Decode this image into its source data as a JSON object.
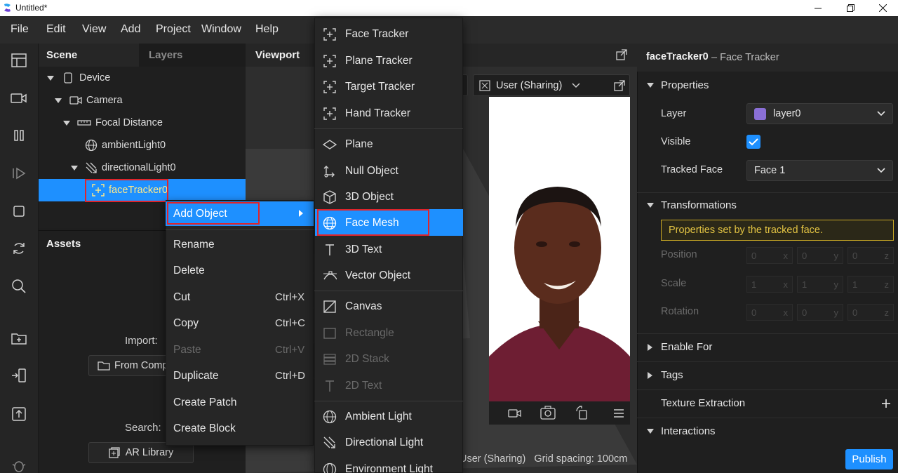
{
  "window": {
    "title": "Untitled*",
    "controls": [
      "—",
      "❐",
      "✕"
    ]
  },
  "menubar": [
    "File",
    "Edit",
    "View",
    "Add",
    "Project",
    "Window",
    "Help"
  ],
  "scene": {
    "tab_scene": "Scene",
    "tab_layers": "Layers",
    "tree": [
      {
        "label": "Device",
        "icon": "phone-icon"
      },
      {
        "label": "Camera",
        "icon": "camera-icon"
      },
      {
        "label": "Focal Distance",
        "icon": "ruler-icon"
      },
      {
        "label": "ambientLight0",
        "icon": "globe-icon"
      },
      {
        "label": "directionalLight0",
        "icon": "directional-light-icon"
      },
      {
        "label": "faceTracker0",
        "icon": "face-tracker-icon"
      }
    ]
  },
  "assets": {
    "title": "Assets",
    "import_label": "Import:",
    "from_computer": "From Comp",
    "search_label": "Search:",
    "ar_library": "AR Library"
  },
  "viewport": {
    "title": "Viewport",
    "sim_mode": "User (Sharing)",
    "status": "User (Sharing)   Grid spacing: 100cm"
  },
  "context_menu": {
    "items": [
      {
        "label": "Add Object",
        "shortcut": "",
        "disabled": false
      },
      {
        "label": "Rename",
        "shortcut": "",
        "disabled": false
      },
      {
        "label": "Delete",
        "shortcut": "",
        "disabled": false
      },
      {
        "label": "Cut",
        "shortcut": "Ctrl+X",
        "disabled": false
      },
      {
        "label": "Copy",
        "shortcut": "Ctrl+C",
        "disabled": false
      },
      {
        "label": "Paste",
        "shortcut": "Ctrl+V",
        "disabled": true
      },
      {
        "label": "Duplicate",
        "shortcut": "Ctrl+D",
        "disabled": false
      },
      {
        "label": "Create Patch",
        "shortcut": "",
        "disabled": false
      },
      {
        "label": "Create Block",
        "shortcut": "",
        "disabled": false
      }
    ]
  },
  "submenu": {
    "items": [
      {
        "label": "Face Tracker",
        "icon": "tracker-icon",
        "disabled": false
      },
      {
        "label": "Plane Tracker",
        "icon": "tracker-icon",
        "disabled": false
      },
      {
        "label": "Target Tracker",
        "icon": "tracker-icon",
        "disabled": false
      },
      {
        "label": "Hand Tracker",
        "icon": "tracker-icon",
        "disabled": false
      },
      {
        "label": "Plane",
        "icon": "plane-icon",
        "disabled": false
      },
      {
        "label": "Null Object",
        "icon": "null-object-icon",
        "disabled": false
      },
      {
        "label": "3D Object",
        "icon": "cube-icon",
        "disabled": false
      },
      {
        "label": "Face Mesh",
        "icon": "globe-icon",
        "disabled": false
      },
      {
        "label": "3D Text",
        "icon": "text-icon",
        "disabled": false
      },
      {
        "label": "Vector Object",
        "icon": "vector-icon",
        "disabled": false
      },
      {
        "label": "Canvas",
        "icon": "canvas-icon",
        "disabled": false
      },
      {
        "label": "Rectangle",
        "icon": "rectangle-icon",
        "disabled": true
      },
      {
        "label": "2D Stack",
        "icon": "stack-icon",
        "disabled": true
      },
      {
        "label": "2D Text",
        "icon": "text-icon",
        "disabled": true
      },
      {
        "label": "Ambient Light",
        "icon": "globe-icon",
        "disabled": false
      },
      {
        "label": "Directional Light",
        "icon": "directional-light-icon",
        "disabled": false
      },
      {
        "label": "Environment Light",
        "icon": "globe-icon",
        "disabled": false
      }
    ]
  },
  "inspector": {
    "object_name": "faceTracker0",
    "object_type": "– Face Tracker",
    "properties_title": "Properties",
    "layer_label": "Layer",
    "layer_value": "layer0",
    "layer_color": "#8a6fd6",
    "visible_label": "Visible",
    "tracked_face_label": "Tracked Face",
    "tracked_face_value": "Face 1",
    "transformations_title": "Transformations",
    "notice": "Properties set by the tracked face.",
    "position_label": "Position",
    "position": [
      "0",
      "0",
      "0"
    ],
    "scale_label": "Scale",
    "scale": [
      "1",
      "1",
      "1"
    ],
    "rotation_label": "Rotation",
    "rotation": [
      "0",
      "0",
      "0"
    ],
    "axis_letters": [
      "x",
      "y",
      "z"
    ],
    "enable_for": "Enable For",
    "tags": "Tags",
    "texture_extraction": "Texture Extraction",
    "interactions": "Interactions",
    "publish": "Publish"
  },
  "colors": {
    "accent": "#1e90ff",
    "highlight": "#e0242b",
    "notice": "#e3c443"
  }
}
